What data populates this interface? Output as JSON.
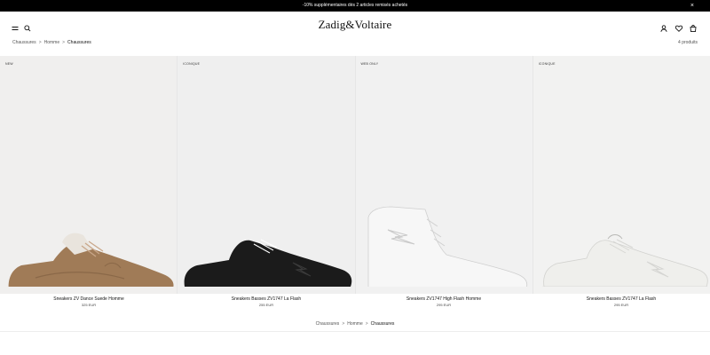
{
  "promo": {
    "text": "-10% supplémentaires dès 2 articles remisés achetés",
    "close_glyph": "×"
  },
  "header": {
    "brand": "Zadig&Voltaire",
    "left_icons": [
      "menu-icon",
      "search-icon"
    ],
    "right_icons": [
      "account-icon",
      "wishlist-heart-icon",
      "bag-icon"
    ]
  },
  "breadcrumb": {
    "items": [
      "Chaussures",
      "Homme",
      "Chaussures"
    ],
    "separator": ">"
  },
  "product_count": "4 produits",
  "products": [
    {
      "badge": "NEW",
      "name": "Sneakers ZV Dance Suede Homme",
      "price": "325 EUR",
      "color": "#a07b57"
    },
    {
      "badge": "ICONIQUE",
      "name": "Sneakers Basses ZV1747 La Flash",
      "price": "255 EUR",
      "color": "#1b1b1b"
    },
    {
      "badge": "WEB ONLY",
      "name": "Sneakers ZV1747 High Flash Homme",
      "price": "295 EUR",
      "color": "#f7f7f7"
    },
    {
      "badge": "ICONIQUE",
      "name": "Sneakers Basses ZV1747 La Flash",
      "price": "295 EUR",
      "color": "#efefec"
    }
  ],
  "bottom_breadcrumb": {
    "items": [
      "Chaussures",
      "Homme",
      "Chaussures"
    ],
    "separator": ">"
  }
}
